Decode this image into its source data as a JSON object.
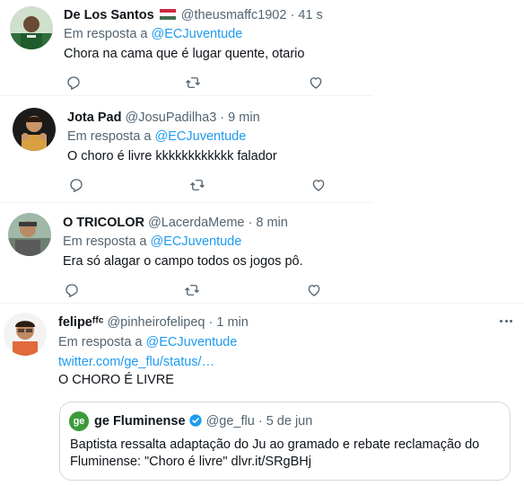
{
  "tweets": [
    {
      "name": "De Los Santos",
      "flag": "hungary-flag",
      "handle": "@theusmaffc1902",
      "sep": "·",
      "time": "41 s",
      "reply_prefix": "Em resposta a",
      "reply_to": "@ECJuventude",
      "text": "Chora na cama que é lugar quente, otario"
    },
    {
      "name": "Jota Pad",
      "handle": "@JosuPadilha3",
      "sep": "·",
      "time": "9 min",
      "reply_prefix": "Em resposta a",
      "reply_to": "@ECJuventude",
      "text": "O choro é livre kkkkkkkkkkkk falador"
    },
    {
      "name": "O TRICOLOR",
      "handle": "@LacerdaMeme",
      "sep": "·",
      "time": "8 min",
      "reply_prefix": "Em resposta a",
      "reply_to": "@ECJuventude",
      "text": "Era só alagar o campo todos os jogos pô."
    },
    {
      "name": "felipeᶠᶠᶜ",
      "handle": "@pinheirofelipeq",
      "sep": "·",
      "time": "1 min",
      "reply_prefix": "Em resposta a",
      "reply_to": "@ECJuventude",
      "link": "twitter.com/ge_flu/status/…",
      "text": "O CHORO É LIVRE"
    }
  ],
  "quote": {
    "logo_text": "ge",
    "name": "ge Fluminense",
    "handle": "@ge_flu",
    "sep": "·",
    "date": "5 de jun",
    "text_line1": "Baptista ressalta adaptação do Ju ao gramado e rebate reclamação do",
    "text_line2": "Fluminense: \"Choro é livre\" dlvr.it/SRgBHj"
  },
  "colors": {
    "link": "#1d9bf0",
    "muted": "#536471",
    "divider": "#eff3f4",
    "verified": "#1d9bf0"
  },
  "icons": [
    "reply-icon",
    "retweet-icon",
    "like-icon",
    "more-icon",
    "verified-icon"
  ]
}
